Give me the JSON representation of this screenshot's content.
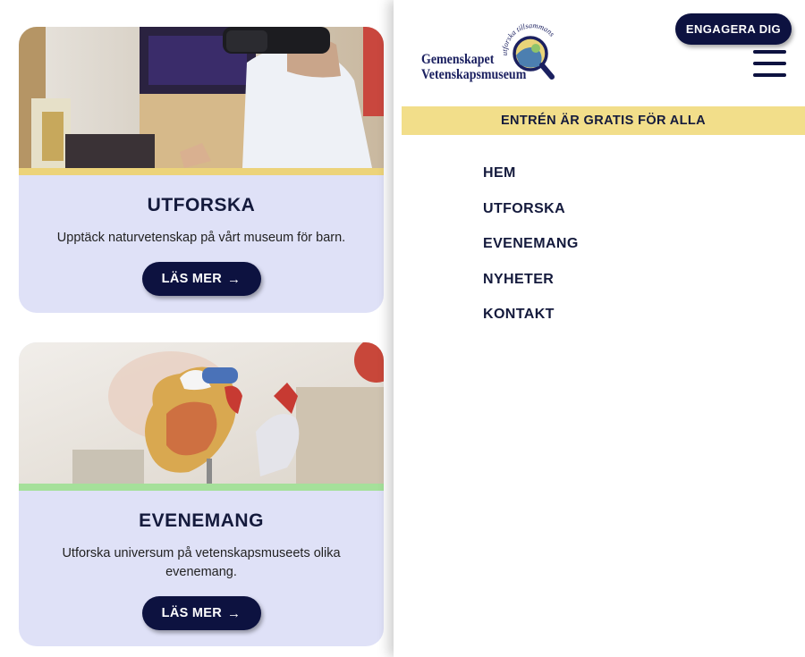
{
  "cards": [
    {
      "title": "UTFORSKA",
      "text": "Upptäck naturvetenskap på vårt museum för barn.",
      "button_label": "LÄS MER",
      "accent_color": "#ecd37a",
      "image_icon": "vr-headset-child-photo"
    },
    {
      "title": "EVENEMANG",
      "text": "Utforska universum på vetenskapsmuseets olika evenemang.",
      "button_label": "LÄS MER",
      "accent_color": "#a5e09a",
      "image_icon": "anatomical-heart-model-photo"
    }
  ],
  "arrow_glyph": "→",
  "drawer": {
    "logo": {
      "line1": "Gemenskapet",
      "line2": "Vetenskapsmuseum",
      "tagline": "utforska tillsammans :)",
      "icon": "magnifying-glass-icon"
    },
    "engage_label": "ENGAGERA DIG",
    "menu_icon": "hamburger-icon",
    "banner": "ENTRÉN ÄR GRATIS FÖR ALLA",
    "nav": [
      "HEM",
      "UTFORSKA",
      "EVENEMANG",
      "NYHETER",
      "KONTAKT"
    ]
  },
  "colors": {
    "navy": "#0d1240",
    "card_bg": "#dfe1f7",
    "banner_bg": "#f2de8a"
  }
}
